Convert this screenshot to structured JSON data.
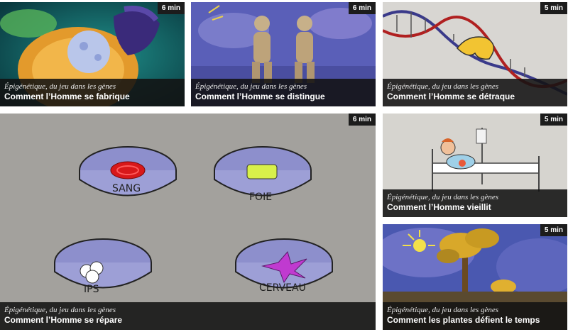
{
  "videos": [
    {
      "subtitle": "Épigénétique, du jeu dans les gènes",
      "title": "Comment l’Homme se fabrique",
      "duration": "6 min"
    },
    {
      "subtitle": "Épigénétique, du jeu dans les gènes",
      "title": "Comment l’Homme se distingue",
      "duration": "6 min"
    },
    {
      "subtitle": "Épigénétique, du jeu dans les gènes",
      "title": "Comment l’Homme se détraque",
      "duration": "5 min"
    },
    {
      "subtitle": "Épigénétique, du jeu dans les gènes",
      "title": "Comment l’Homme se répare",
      "duration": "6 min",
      "dish_labels": {
        "sang": "SANG",
        "foie": "FOIE",
        "ips": "IPS",
        "cerveau": "CERVEAU"
      }
    },
    {
      "subtitle": "Épigénétique, du jeu dans les gènes",
      "title": "Comment l’Homme vieillit",
      "duration": "5 min"
    },
    {
      "subtitle": "Épigénétique, du jeu dans les gènes",
      "title": "Comment les plantes défient le temps",
      "duration": "5 min"
    }
  ],
  "colors": {
    "caption_bg": "#121212",
    "duration_bg": "#1c1c1c",
    "page_bg": "#ffffff"
  }
}
